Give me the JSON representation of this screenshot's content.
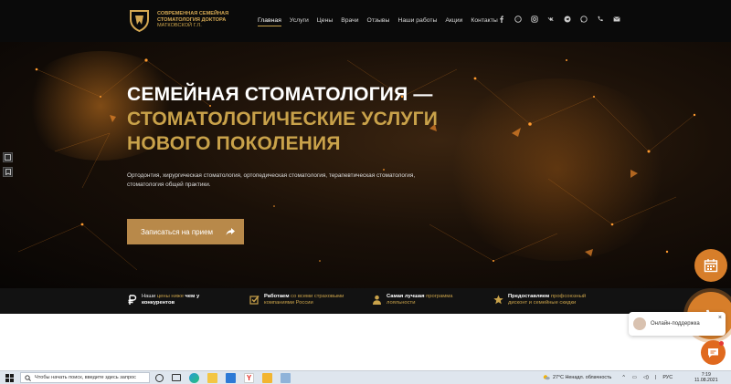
{
  "header": {
    "logo_line1": "Современная семейная",
    "logo_line2": "стоматология доктора",
    "logo_line3": "Матковской Г.Л.",
    "nav": [
      "Главная",
      "Услуги",
      "Цены",
      "Врачи",
      "Отзывы",
      "Наши работы",
      "Акции",
      "Контакты"
    ],
    "social_icons": [
      "facebook-icon",
      "messenger-icon",
      "instagram-icon",
      "vk-icon",
      "telegram-icon",
      "whatsapp-icon",
      "phone-icon",
      "mail-icon"
    ]
  },
  "hero": {
    "title_line1": "СЕМЕЙНАЯ СТОМАТОЛОГИЯ —",
    "title_line2": "СТОМАТОЛОГИЧЕСКИЕ УСЛУГИ",
    "title_line3": "НОВОГО ПОКОЛЕНИЯ",
    "description": "Ортодонтия, хирургическая стоматология, ортопедическая стоматология, терапевтическая стоматология, стоматология общей практики.",
    "button_label": "Записаться на прием"
  },
  "features": [
    {
      "a": "Наши ",
      "b": "цены ниже",
      "c": " чем у",
      "d": "конкурентов"
    },
    {
      "a": "Работаем ",
      "b": "со всеми страховыми",
      "c": "",
      "d": "компаниями России"
    },
    {
      "a": "Самая лучшая ",
      "b": "программа",
      "c": "",
      "d": "лояльности"
    },
    {
      "a": "Предоставляем ",
      "b": "профсоюзный",
      "c": "",
      "d": "дисконт и семейные скидки"
    }
  ],
  "support_popup": {
    "label": "Онлайн-поддержка",
    "close": "×"
  },
  "taskbar": {
    "search_placeholder": "Чтобы начать поиск, введите здесь запрос",
    "weather": "27°C  Ненадл. облачность",
    "lang": "РУС",
    "time": "7:19",
    "date": "11.08.2021"
  },
  "colors": {
    "gold": "#c9a24a",
    "button": "#b8894a",
    "fab": "#d77e2a"
  }
}
